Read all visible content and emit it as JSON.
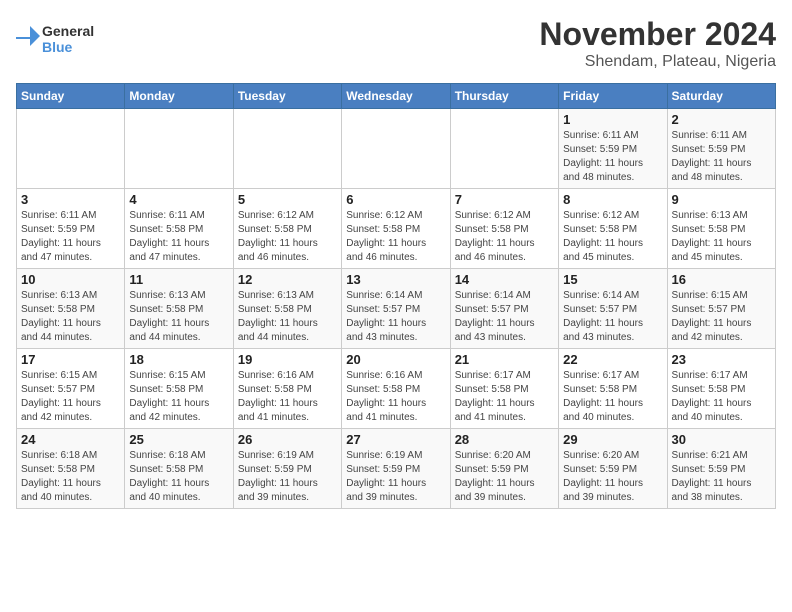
{
  "logo": {
    "line1": "General",
    "line2": "Blue"
  },
  "header": {
    "month": "November 2024",
    "location": "Shendam, Plateau, Nigeria"
  },
  "weekdays": [
    "Sunday",
    "Monday",
    "Tuesday",
    "Wednesday",
    "Thursday",
    "Friday",
    "Saturday"
  ],
  "weeks": [
    [
      {
        "day": "",
        "info": ""
      },
      {
        "day": "",
        "info": ""
      },
      {
        "day": "",
        "info": ""
      },
      {
        "day": "",
        "info": ""
      },
      {
        "day": "",
        "info": ""
      },
      {
        "day": "1",
        "info": "Sunrise: 6:11 AM\nSunset: 5:59 PM\nDaylight: 11 hours\nand 48 minutes."
      },
      {
        "day": "2",
        "info": "Sunrise: 6:11 AM\nSunset: 5:59 PM\nDaylight: 11 hours\nand 48 minutes."
      }
    ],
    [
      {
        "day": "3",
        "info": "Sunrise: 6:11 AM\nSunset: 5:59 PM\nDaylight: 11 hours\nand 47 minutes."
      },
      {
        "day": "4",
        "info": "Sunrise: 6:11 AM\nSunset: 5:58 PM\nDaylight: 11 hours\nand 47 minutes."
      },
      {
        "day": "5",
        "info": "Sunrise: 6:12 AM\nSunset: 5:58 PM\nDaylight: 11 hours\nand 46 minutes."
      },
      {
        "day": "6",
        "info": "Sunrise: 6:12 AM\nSunset: 5:58 PM\nDaylight: 11 hours\nand 46 minutes."
      },
      {
        "day": "7",
        "info": "Sunrise: 6:12 AM\nSunset: 5:58 PM\nDaylight: 11 hours\nand 46 minutes."
      },
      {
        "day": "8",
        "info": "Sunrise: 6:12 AM\nSunset: 5:58 PM\nDaylight: 11 hours\nand 45 minutes."
      },
      {
        "day": "9",
        "info": "Sunrise: 6:13 AM\nSunset: 5:58 PM\nDaylight: 11 hours\nand 45 minutes."
      }
    ],
    [
      {
        "day": "10",
        "info": "Sunrise: 6:13 AM\nSunset: 5:58 PM\nDaylight: 11 hours\nand 44 minutes."
      },
      {
        "day": "11",
        "info": "Sunrise: 6:13 AM\nSunset: 5:58 PM\nDaylight: 11 hours\nand 44 minutes."
      },
      {
        "day": "12",
        "info": "Sunrise: 6:13 AM\nSunset: 5:58 PM\nDaylight: 11 hours\nand 44 minutes."
      },
      {
        "day": "13",
        "info": "Sunrise: 6:14 AM\nSunset: 5:57 PM\nDaylight: 11 hours\nand 43 minutes."
      },
      {
        "day": "14",
        "info": "Sunrise: 6:14 AM\nSunset: 5:57 PM\nDaylight: 11 hours\nand 43 minutes."
      },
      {
        "day": "15",
        "info": "Sunrise: 6:14 AM\nSunset: 5:57 PM\nDaylight: 11 hours\nand 43 minutes."
      },
      {
        "day": "16",
        "info": "Sunrise: 6:15 AM\nSunset: 5:57 PM\nDaylight: 11 hours\nand 42 minutes."
      }
    ],
    [
      {
        "day": "17",
        "info": "Sunrise: 6:15 AM\nSunset: 5:57 PM\nDaylight: 11 hours\nand 42 minutes."
      },
      {
        "day": "18",
        "info": "Sunrise: 6:15 AM\nSunset: 5:58 PM\nDaylight: 11 hours\nand 42 minutes."
      },
      {
        "day": "19",
        "info": "Sunrise: 6:16 AM\nSunset: 5:58 PM\nDaylight: 11 hours\nand 41 minutes."
      },
      {
        "day": "20",
        "info": "Sunrise: 6:16 AM\nSunset: 5:58 PM\nDaylight: 11 hours\nand 41 minutes."
      },
      {
        "day": "21",
        "info": "Sunrise: 6:17 AM\nSunset: 5:58 PM\nDaylight: 11 hours\nand 41 minutes."
      },
      {
        "day": "22",
        "info": "Sunrise: 6:17 AM\nSunset: 5:58 PM\nDaylight: 11 hours\nand 40 minutes."
      },
      {
        "day": "23",
        "info": "Sunrise: 6:17 AM\nSunset: 5:58 PM\nDaylight: 11 hours\nand 40 minutes."
      }
    ],
    [
      {
        "day": "24",
        "info": "Sunrise: 6:18 AM\nSunset: 5:58 PM\nDaylight: 11 hours\nand 40 minutes."
      },
      {
        "day": "25",
        "info": "Sunrise: 6:18 AM\nSunset: 5:58 PM\nDaylight: 11 hours\nand 40 minutes."
      },
      {
        "day": "26",
        "info": "Sunrise: 6:19 AM\nSunset: 5:59 PM\nDaylight: 11 hours\nand 39 minutes."
      },
      {
        "day": "27",
        "info": "Sunrise: 6:19 AM\nSunset: 5:59 PM\nDaylight: 11 hours\nand 39 minutes."
      },
      {
        "day": "28",
        "info": "Sunrise: 6:20 AM\nSunset: 5:59 PM\nDaylight: 11 hours\nand 39 minutes."
      },
      {
        "day": "29",
        "info": "Sunrise: 6:20 AM\nSunset: 5:59 PM\nDaylight: 11 hours\nand 39 minutes."
      },
      {
        "day": "30",
        "info": "Sunrise: 6:21 AM\nSunset: 5:59 PM\nDaylight: 11 hours\nand 38 minutes."
      }
    ]
  ]
}
